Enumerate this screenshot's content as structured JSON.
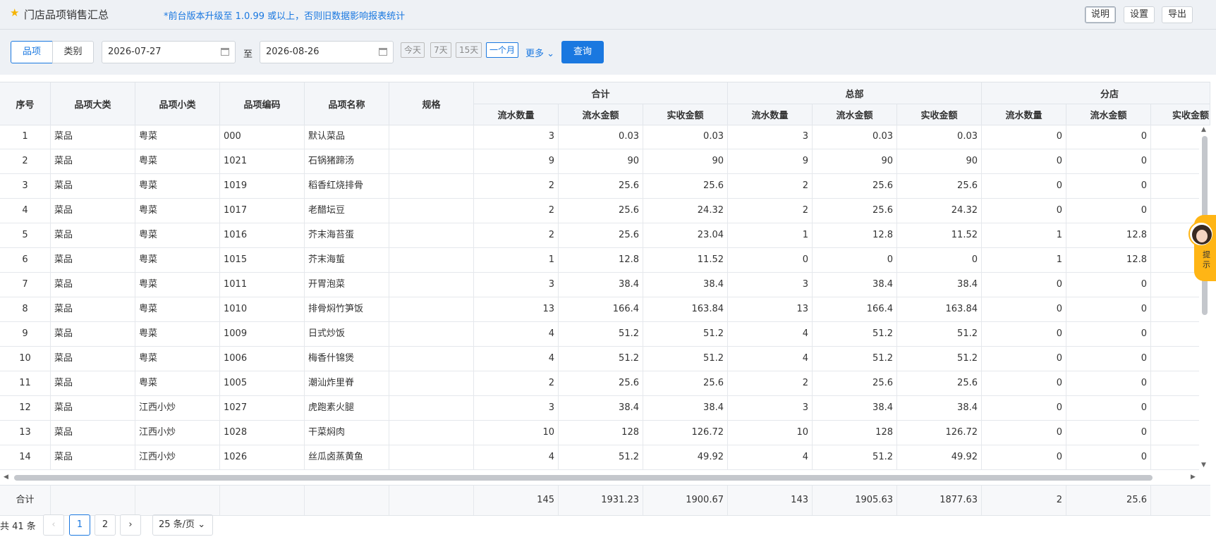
{
  "header": {
    "title": "门店品项销售汇总",
    "notice": "*前台版本升级至 1.0.99 或以上，否则旧数据影响报表统计",
    "buttons": {
      "explain": "说明",
      "settings": "设置",
      "export": "导出"
    }
  },
  "filters": {
    "mode_item": "品项",
    "mode_category": "类别",
    "start_date": "2026-07-27",
    "to_label": "至",
    "end_date": "2026-08-26",
    "quick": {
      "today": "今天",
      "d7": "7天",
      "d15": "15天",
      "month": "一个月"
    },
    "more": "更多",
    "query": "查询"
  },
  "table": {
    "headers": {
      "seq": "序号",
      "cat_major": "品项大类",
      "cat_minor": "品项小类",
      "code": "品项编码",
      "name": "品项名称",
      "spec": "规格",
      "group_total": "合计",
      "group_hq": "总部",
      "group_branch": "分店",
      "qty": "流水数量",
      "flow_amt": "流水金额",
      "recv_amt": "实收金额"
    },
    "rows": [
      {
        "seq": "1",
        "major": "菜品",
        "minor": "粤菜",
        "code": "000",
        "name": "默认菜品",
        "spec": "",
        "t_qty": "3",
        "t_flow": "0.03",
        "t_recv": "0.03",
        "h_qty": "3",
        "h_flow": "0.03",
        "h_recv": "0.03",
        "b_qty": "0",
        "b_flow": "0"
      },
      {
        "seq": "2",
        "major": "菜品",
        "minor": "粤菜",
        "code": "1021",
        "name": "石锅猪蹄汤",
        "spec": "",
        "t_qty": "9",
        "t_flow": "90",
        "t_recv": "90",
        "h_qty": "9",
        "h_flow": "90",
        "h_recv": "90",
        "b_qty": "0",
        "b_flow": "0"
      },
      {
        "seq": "3",
        "major": "菜品",
        "minor": "粤菜",
        "code": "1019",
        "name": "稻香红烧排骨",
        "spec": "",
        "t_qty": "2",
        "t_flow": "25.6",
        "t_recv": "25.6",
        "h_qty": "2",
        "h_flow": "25.6",
        "h_recv": "25.6",
        "b_qty": "0",
        "b_flow": "0"
      },
      {
        "seq": "4",
        "major": "菜品",
        "minor": "粤菜",
        "code": "1017",
        "name": "老醋坛豆",
        "spec": "",
        "t_qty": "2",
        "t_flow": "25.6",
        "t_recv": "24.32",
        "h_qty": "2",
        "h_flow": "25.6",
        "h_recv": "24.32",
        "b_qty": "0",
        "b_flow": "0"
      },
      {
        "seq": "5",
        "major": "菜品",
        "minor": "粤菜",
        "code": "1016",
        "name": "芥末海苔蛋",
        "spec": "",
        "t_qty": "2",
        "t_flow": "25.6",
        "t_recv": "23.04",
        "h_qty": "1",
        "h_flow": "12.8",
        "h_recv": "11.52",
        "b_qty": "1",
        "b_flow": "12.8"
      },
      {
        "seq": "6",
        "major": "菜品",
        "minor": "粤菜",
        "code": "1015",
        "name": "芥末海蜇",
        "spec": "",
        "t_qty": "1",
        "t_flow": "12.8",
        "t_recv": "11.52",
        "h_qty": "0",
        "h_flow": "0",
        "h_recv": "0",
        "b_qty": "1",
        "b_flow": "12.8"
      },
      {
        "seq": "7",
        "major": "菜品",
        "minor": "粤菜",
        "code": "1011",
        "name": "开胃泡菜",
        "spec": "",
        "t_qty": "3",
        "t_flow": "38.4",
        "t_recv": "38.4",
        "h_qty": "3",
        "h_flow": "38.4",
        "h_recv": "38.4",
        "b_qty": "0",
        "b_flow": "0"
      },
      {
        "seq": "8",
        "major": "菜品",
        "minor": "粤菜",
        "code": "1010",
        "name": "排骨焖竹笋饭",
        "spec": "",
        "t_qty": "13",
        "t_flow": "166.4",
        "t_recv": "163.84",
        "h_qty": "13",
        "h_flow": "166.4",
        "h_recv": "163.84",
        "b_qty": "0",
        "b_flow": "0"
      },
      {
        "seq": "9",
        "major": "菜品",
        "minor": "粤菜",
        "code": "1009",
        "name": "日式炒饭",
        "spec": "",
        "t_qty": "4",
        "t_flow": "51.2",
        "t_recv": "51.2",
        "h_qty": "4",
        "h_flow": "51.2",
        "h_recv": "51.2",
        "b_qty": "0",
        "b_flow": "0"
      },
      {
        "seq": "10",
        "major": "菜品",
        "minor": "粤菜",
        "code": "1006",
        "name": "梅香什锦煲",
        "spec": "",
        "t_qty": "4",
        "t_flow": "51.2",
        "t_recv": "51.2",
        "h_qty": "4",
        "h_flow": "51.2",
        "h_recv": "51.2",
        "b_qty": "0",
        "b_flow": "0"
      },
      {
        "seq": "11",
        "major": "菜品",
        "minor": "粤菜",
        "code": "1005",
        "name": "潮汕炸里脊",
        "spec": "",
        "t_qty": "2",
        "t_flow": "25.6",
        "t_recv": "25.6",
        "h_qty": "2",
        "h_flow": "25.6",
        "h_recv": "25.6",
        "b_qty": "0",
        "b_flow": "0"
      },
      {
        "seq": "12",
        "major": "菜品",
        "minor": "江西小炒",
        "code": "1027",
        "name": "虎跑素火腿",
        "spec": "",
        "t_qty": "3",
        "t_flow": "38.4",
        "t_recv": "38.4",
        "h_qty": "3",
        "h_flow": "38.4",
        "h_recv": "38.4",
        "b_qty": "0",
        "b_flow": "0"
      },
      {
        "seq": "13",
        "major": "菜品",
        "minor": "江西小炒",
        "code": "1028",
        "name": "干菜焖肉",
        "spec": "",
        "t_qty": "10",
        "t_flow": "128",
        "t_recv": "126.72",
        "h_qty": "10",
        "h_flow": "128",
        "h_recv": "126.72",
        "b_qty": "0",
        "b_flow": "0"
      },
      {
        "seq": "14",
        "major": "菜品",
        "minor": "江西小炒",
        "code": "1026",
        "name": "丝瓜卤蒸黄鱼",
        "spec": "",
        "t_qty": "4",
        "t_flow": "51.2",
        "t_recv": "49.92",
        "h_qty": "4",
        "h_flow": "51.2",
        "h_recv": "49.92",
        "b_qty": "0",
        "b_flow": "0"
      }
    ],
    "totals": {
      "label": "合计",
      "t_qty": "145",
      "t_flow": "1931.23",
      "t_recv": "1900.67",
      "h_qty": "143",
      "h_flow": "1905.63",
      "h_recv": "1877.63",
      "b_qty": "2",
      "b_flow": "25.6"
    }
  },
  "pagination": {
    "total": "共 41 条",
    "pages": [
      "1",
      "2"
    ],
    "current": "1",
    "page_size": "25 条/页"
  },
  "helper": {
    "label": "提示"
  }
}
